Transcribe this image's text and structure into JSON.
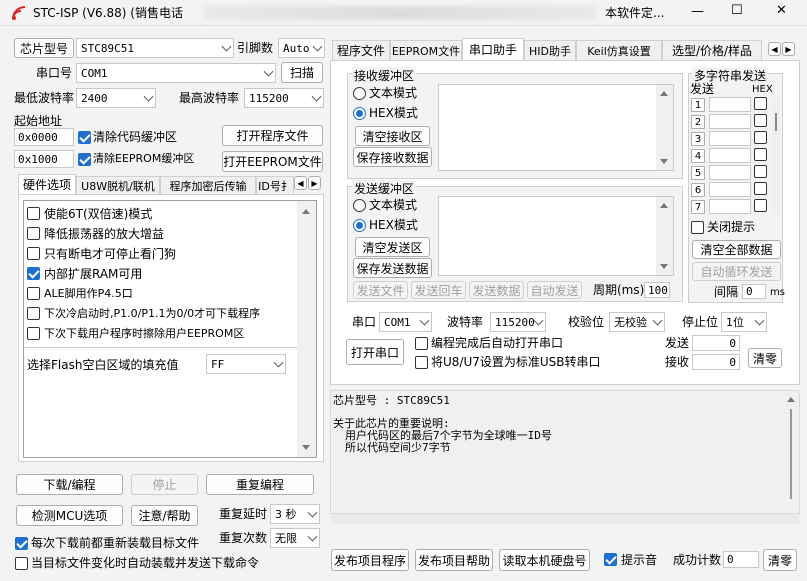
{
  "titlebar": {
    "title": "STC-ISP (V6.88) (销售电话",
    "right_text": "本软件定...",
    "minimize": "—",
    "maximize": "☐",
    "close": "✕"
  },
  "left": {
    "chip_type_label": "芯片型号",
    "chip_type_value": "STC89C51",
    "pin_count_label": "引脚数",
    "pin_count_value": "Auto",
    "serial_port_label": "串口号",
    "serial_port_value": "COM1",
    "scan_button": "扫描",
    "min_baud_label": "最低波特率",
    "min_baud_value": "2400",
    "max_baud_label": "最高波特率",
    "max_baud_value": "115200",
    "start_addr_label": "起始地址",
    "addr1_value": "0x0000",
    "clear_code_label": "清除代码缓冲区",
    "open_program_button": "打开程序文件",
    "addr2_value": "0x1000",
    "clear_eeprom_label": "清除EEPROM缓冲区",
    "open_eeprom_button": "打开EEPROM文件",
    "tabs": [
      "硬件选项",
      "U8W脱机/联机",
      "程序加密后传输",
      "ID号扌"
    ],
    "options": [
      {
        "label": "使能6T(双倍速)模式",
        "checked": false
      },
      {
        "label": "降低振荡器的放大增益",
        "checked": false
      },
      {
        "label": "只有断电才可停止看门狗",
        "checked": false
      },
      {
        "label": "内部扩展RAM可用",
        "checked": true
      },
      {
        "label": "ALE脚用作P4.5口",
        "checked": false
      },
      {
        "label": "下次冷启动时,P1.0/P1.1为0/0才可下载程序",
        "checked": false
      },
      {
        "label": "下次下载用户程序时擦除用户EEPROM区",
        "checked": false
      }
    ],
    "flash_fill_label": "选择Flash空白区域的填充值",
    "flash_fill_value": "FF",
    "download_button": "下载/编程",
    "stop_button": "停止",
    "reprogram_button": "重复编程",
    "detect_mcu_button": "检测MCU选项",
    "help_button": "注意/帮助",
    "repeat_delay_label": "重复延时",
    "repeat_delay_value": "3 秒",
    "reload_label": "每次下载前都重新装载目标文件",
    "repeat_count_label": "重复次数",
    "repeat_count_value": "无限",
    "auto_load_label": "当目标文件变化时自动装载并发送下载命令"
  },
  "right": {
    "tabs": [
      "程序文件",
      "EEPROM文件",
      "串口助手",
      "HID助手",
      "Keil仿真设置",
      "选型/价格/样品"
    ],
    "receive_title": "接收缓冲区",
    "text_mode": "文本模式",
    "hex_mode": "HEX模式",
    "clear_receive_button": "清空接收区",
    "save_receive_button": "保存接收数据",
    "send_title": "发送缓冲区",
    "send_text_mode": "文本模式",
    "send_hex_mode": "HEX模式",
    "clear_send_button": "清空发送区",
    "save_send_button": "保存发送数据",
    "send_file_button": "发送文件",
    "send_enter_button": "发送回车",
    "send_data_button": "发送数据",
    "auto_send_button": "自动发送",
    "period_label": "周期(ms)",
    "period_value": "100",
    "multi_title": "多字符串发送",
    "multi_send_col": "发送",
    "multi_hex_col": "HEX",
    "multi_rows": [
      "1",
      "2",
      "3",
      "4",
      "5",
      "6",
      "7"
    ],
    "close_tip_label": "关闭提示",
    "clear_all_button": "清空全部数据",
    "auto_cycle_button": "自动循环发送",
    "interval_label": "间隔",
    "interval_value": "0",
    "interval_unit": "ms",
    "port_label": "串口",
    "port_value": "COM1",
    "baud_label": "波特率",
    "baud_value": "115200",
    "parity_label": "校验位",
    "parity_value": "无校验",
    "stopbit_label": "停止位",
    "stopbit_value": "1位",
    "open_port_button": "打开串口",
    "auto_open_label": "编程完成后自动打开串口",
    "usb_label": "将U8/U7设置为标准USB转串口",
    "send_count_label": "发送",
    "send_count_value": "0",
    "recv_count_label": "接收",
    "recv_count_value": "0",
    "clear_count_button": "清零",
    "info_chip": "芯片型号 : STC89C51",
    "info_line1": "关于此芯片的重要说明:",
    "info_line2": "用户代码区的最后7个字节为全球唯一ID号",
    "info_line3": "所以代码空间少7字节",
    "publish_program_button": "发布项目程序",
    "publish_help_button": "发布项目帮助",
    "read_disk_button": "读取本机硬盘号",
    "beep_label": "提示音",
    "success_count_label": "成功计数",
    "success_count_value": "0",
    "clear_success_button": "清零"
  }
}
